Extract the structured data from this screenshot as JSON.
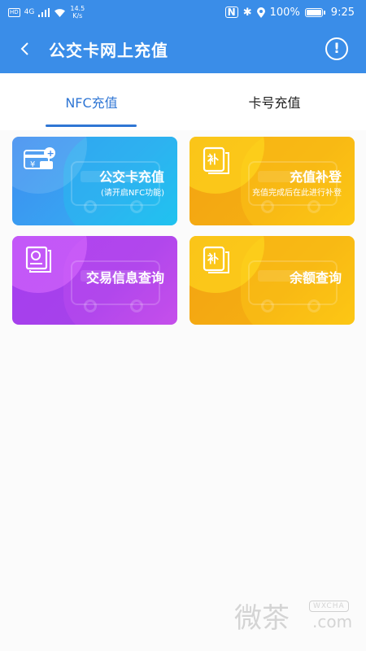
{
  "status_bar": {
    "hd": "HD",
    "network": "4G",
    "speed_value": "14.5",
    "speed_unit": "K/s",
    "battery": "100%",
    "time": "9:25"
  },
  "header": {
    "title": "公交卡网上充值",
    "info_symbol": "!"
  },
  "tabs": [
    {
      "label": "NFC充值",
      "active": true
    },
    {
      "label": "卡号充值",
      "active": false
    }
  ],
  "cards": [
    {
      "title": "公交卡充值",
      "subtitle": "(请开启NFC功能)"
    },
    {
      "title": "充值补登",
      "subtitle": "充值完成后在此进行补登",
      "icon_char": "补"
    },
    {
      "title": "交易信息查询"
    },
    {
      "title": "余额查询",
      "icon_char": "补"
    }
  ],
  "watermark": {
    "chinese": "微茶",
    "english": "WXCHA",
    "domain": ".com"
  },
  "colors": {
    "header_blue": "#3a8de8",
    "tab_active": "#2f76d4",
    "card_blue": "#3e8cf0",
    "card_orange": "#f5ad12",
    "card_purple": "#a642ea"
  }
}
